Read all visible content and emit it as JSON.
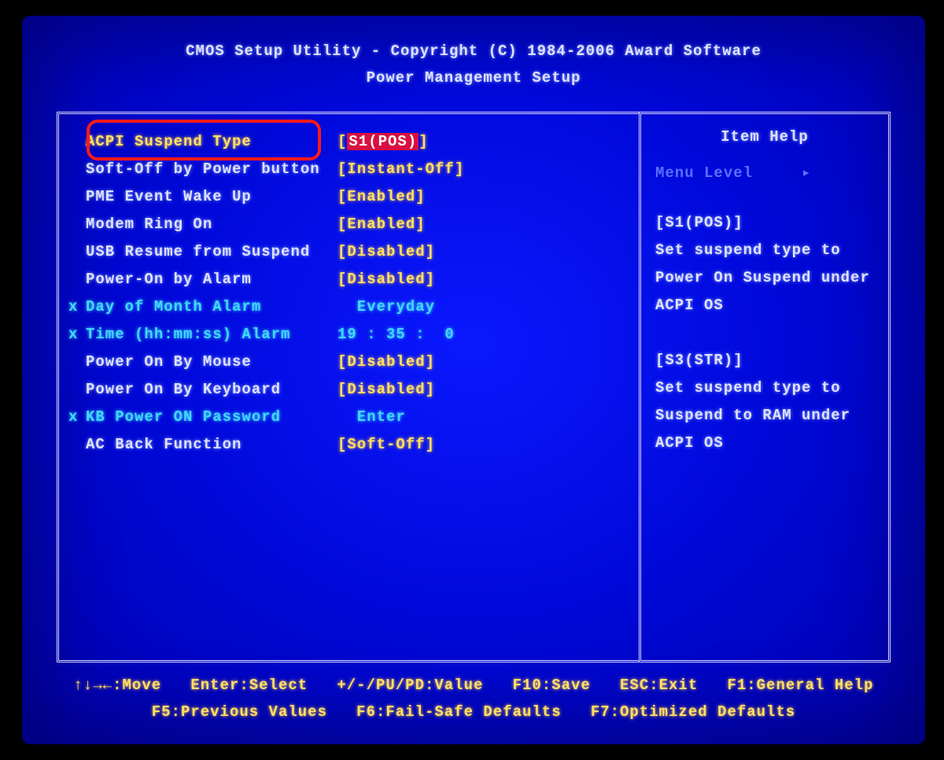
{
  "header": {
    "title": "CMOS Setup Utility - Copyright (C) 1984-2006 Award Software",
    "subtitle": "Power Management Setup"
  },
  "settings": [
    {
      "mark": "",
      "label": "ACPI Suspend Type",
      "value": "S1(POS)",
      "bracket": true,
      "selected": true,
      "disabled": false
    },
    {
      "mark": "",
      "label": "Soft-Off by Power button",
      "value": "Instant-Off",
      "bracket": true,
      "selected": false,
      "disabled": false
    },
    {
      "mark": "",
      "label": "PME Event Wake Up",
      "value": "Enabled",
      "bracket": true,
      "selected": false,
      "disabled": false
    },
    {
      "mark": "",
      "label": "Modem Ring On",
      "value": "Enabled",
      "bracket": true,
      "selected": false,
      "disabled": false
    },
    {
      "mark": "",
      "label": "USB Resume from Suspend",
      "value": "Disabled",
      "bracket": true,
      "selected": false,
      "disabled": false
    },
    {
      "mark": "",
      "label": "Power-On by Alarm",
      "value": "Disabled",
      "bracket": true,
      "selected": false,
      "disabled": false
    },
    {
      "mark": "x",
      "label": "Day of Month Alarm",
      "value": "  Everyday",
      "bracket": false,
      "selected": false,
      "disabled": true
    },
    {
      "mark": "x",
      "label": "Time (hh:mm:ss) Alarm",
      "value": "19 : 35 :  0",
      "bracket": false,
      "selected": false,
      "disabled": true
    },
    {
      "mark": "",
      "label": "Power On By Mouse",
      "value": "Disabled",
      "bracket": true,
      "selected": false,
      "disabled": false
    },
    {
      "mark": "",
      "label": "Power On By Keyboard",
      "value": "Disabled",
      "bracket": true,
      "selected": false,
      "disabled": false
    },
    {
      "mark": "x",
      "label": "KB Power ON Password",
      "value": "  Enter",
      "bracket": false,
      "selected": false,
      "disabled": true
    },
    {
      "mark": "",
      "label": "AC Back Function",
      "value": "Soft-Off",
      "bracket": true,
      "selected": false,
      "disabled": false
    }
  ],
  "help": {
    "title": "Item Help",
    "menu_level": "Menu Level     ▸",
    "lines": [
      "[S1(POS)]",
      "Set suspend type to",
      "Power On Suspend under",
      "ACPI OS",
      "",
      "[S3(STR)]",
      "Set suspend type to",
      "Suspend to RAM under",
      "ACPI OS"
    ]
  },
  "footer": {
    "line1": "↑↓→←:Move   Enter:Select   +/-/PU/PD:Value   F10:Save   ESC:Exit   F1:General Help",
    "line2": "F5:Previous Values   F6:Fail-Safe Defaults   F7:Optimized Defaults"
  }
}
